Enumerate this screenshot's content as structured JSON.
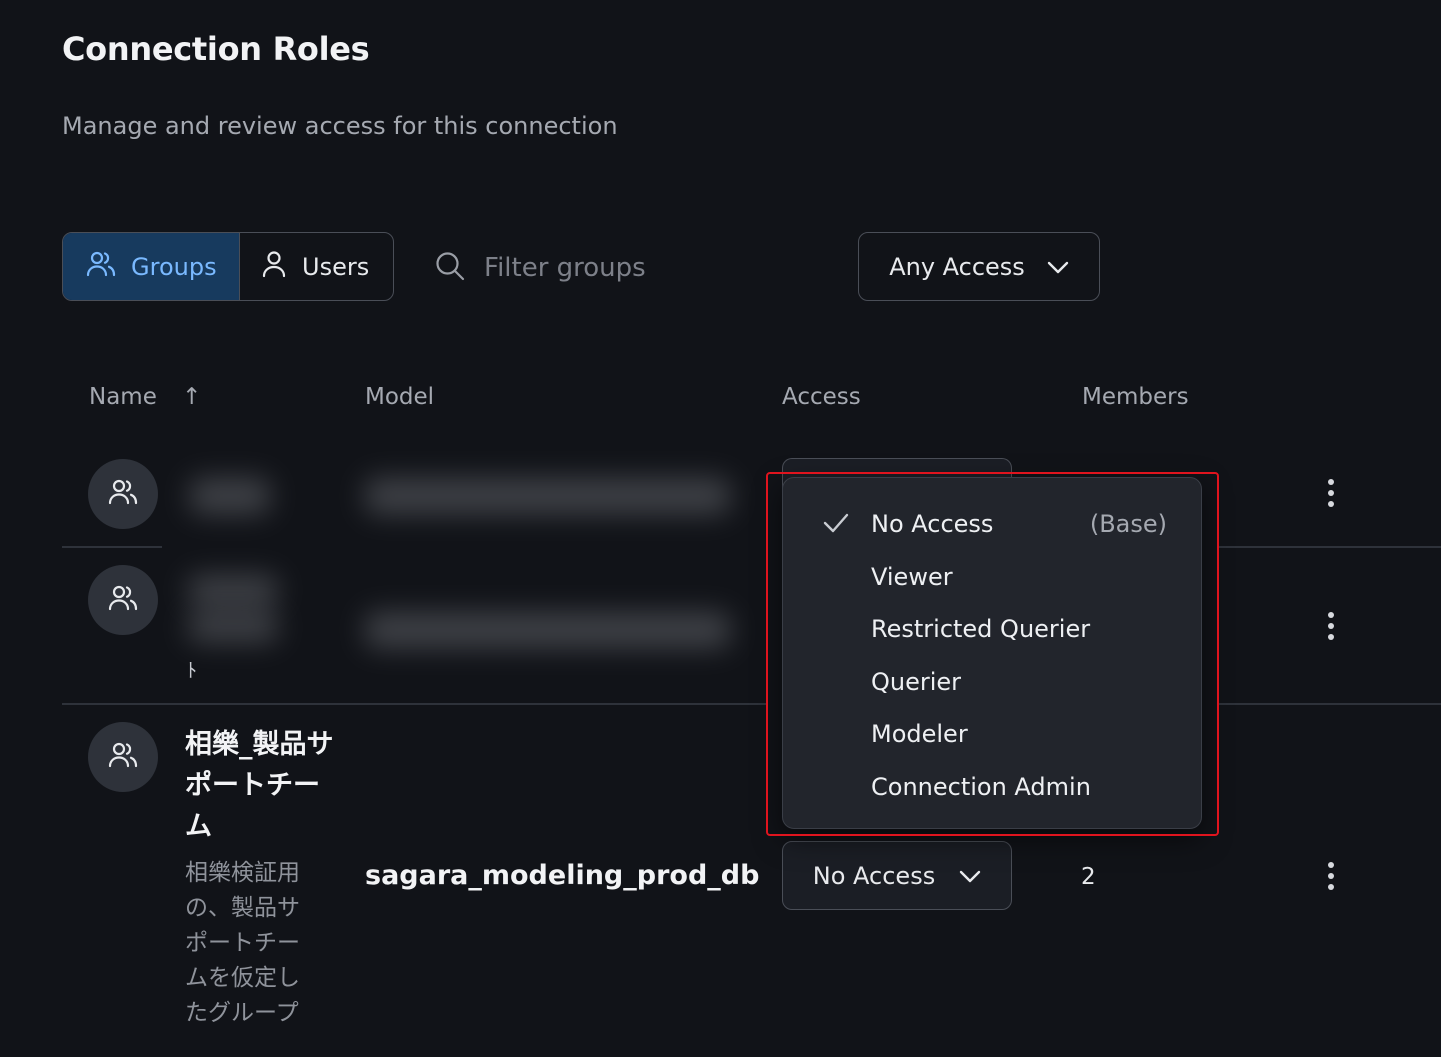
{
  "header": {
    "title": "Connection Roles",
    "subtitle": "Manage and review access for this connection"
  },
  "toolbar": {
    "tabs": [
      {
        "label": "Groups",
        "icon": "users-icon",
        "active": true
      },
      {
        "label": "Users",
        "icon": "user-icon",
        "active": false
      }
    ],
    "filter_placeholder": "Filter groups",
    "access_filter": {
      "label": "Any Access",
      "icon": "chevron-down-icon"
    }
  },
  "table": {
    "columns": {
      "name": "Name",
      "model": "Model",
      "access": "Access",
      "members": "Members"
    },
    "sort_indicator": "↑",
    "rows": [
      {
        "name": "",
        "model": "",
        "access": "",
        "members": "",
        "redacted": true
      },
      {
        "name": "",
        "model": "",
        "access": "",
        "members": "",
        "redacted": true,
        "fragment": "ﾄ"
      },
      {
        "name": "相樂_製品サポートチーム",
        "description": "相樂検証用の、製品サポートチームを仮定したグループ",
        "model": "sagara_modeling_prod_db",
        "access": "No Access",
        "members": "2"
      }
    ]
  },
  "access_menu": {
    "selected": "No Access",
    "items": [
      {
        "label": "No Access",
        "tag": "(Base)",
        "checked": true
      },
      {
        "label": "Viewer",
        "tag": "",
        "checked": false
      },
      {
        "label": "Restricted Querier",
        "tag": "",
        "checked": false
      },
      {
        "label": "Querier",
        "tag": "",
        "checked": false
      },
      {
        "label": "Modeler",
        "tag": "",
        "checked": false
      },
      {
        "label": "Connection Admin",
        "tag": "",
        "checked": false
      }
    ]
  },
  "colors": {
    "background": "#111318",
    "accent": "#7ab9ff",
    "active_tab_bg": "#173a5e",
    "highlight_border": "#e0141e"
  }
}
